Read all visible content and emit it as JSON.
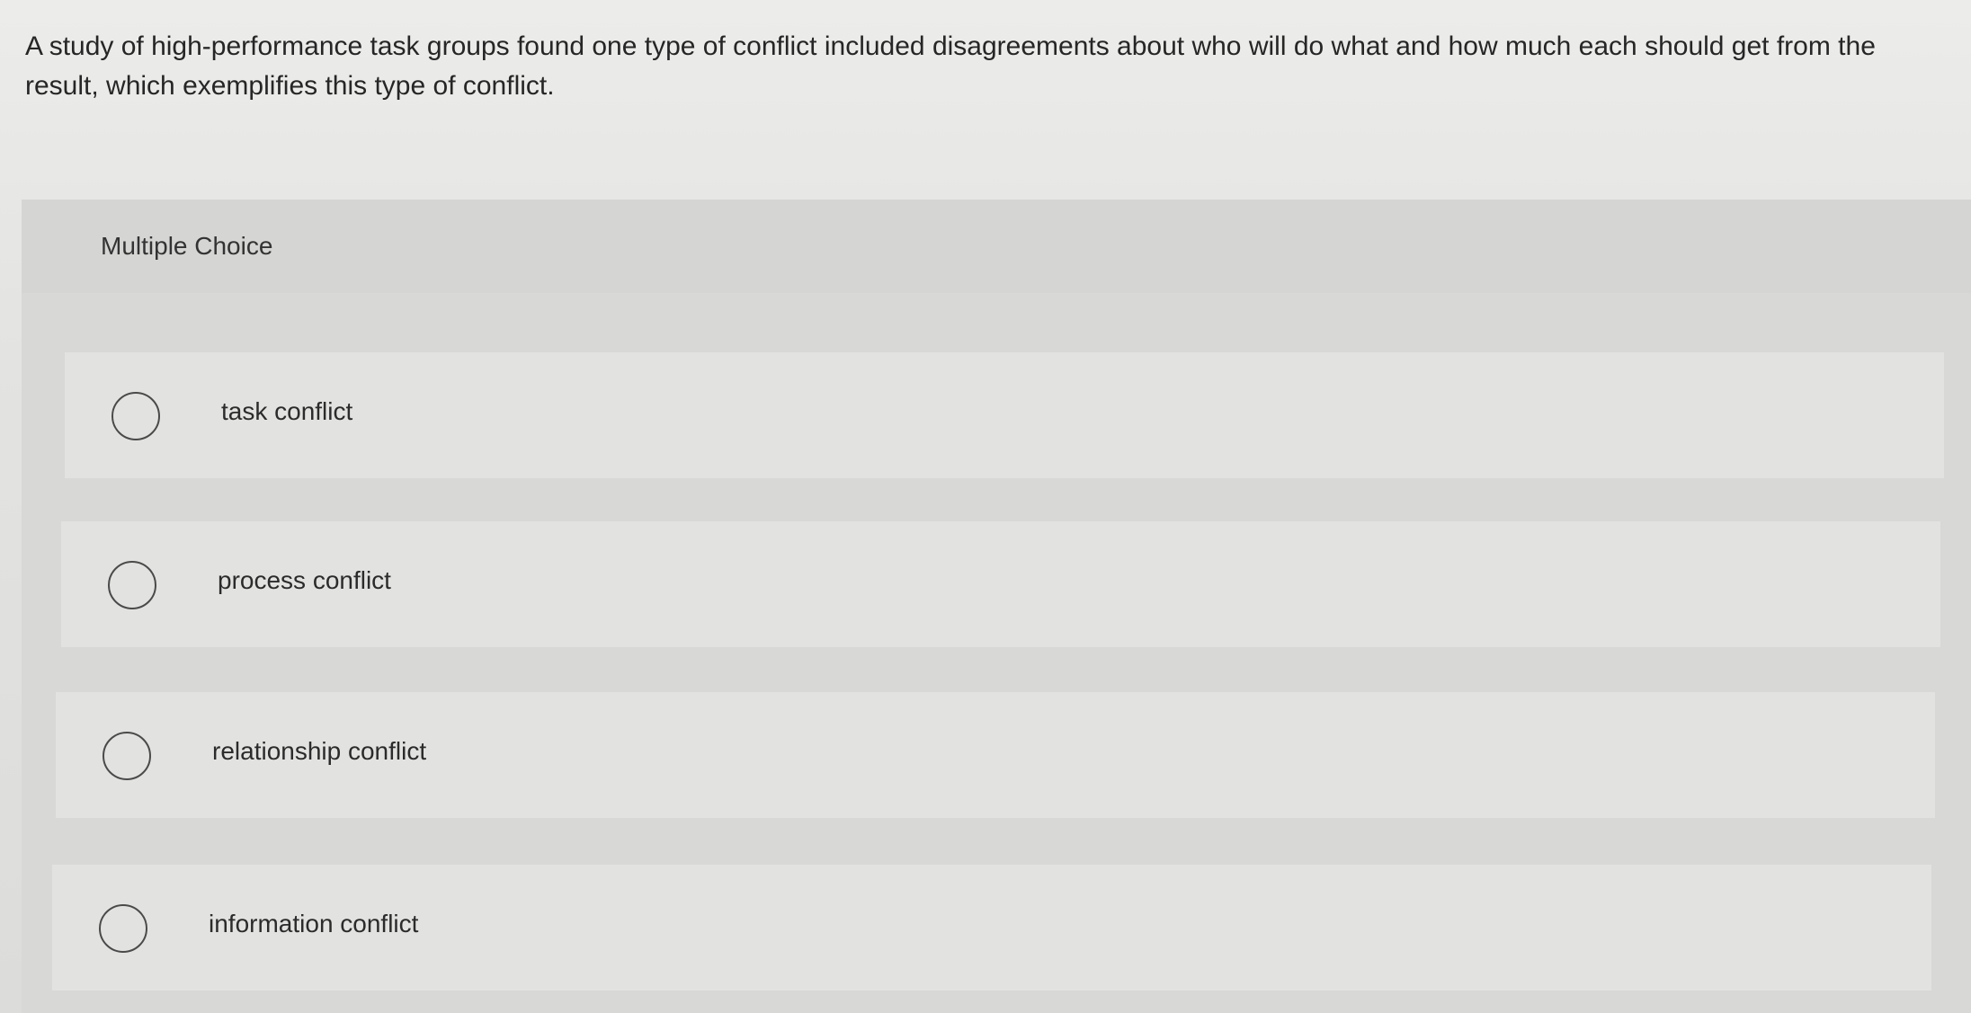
{
  "question": {
    "text": "A study of high-performance task groups found one type of conflict included disagreements about who will do what and how much each should get from the result, which exemplifies this type of conflict."
  },
  "multiple_choice": {
    "label": "Multiple Choice",
    "options": [
      {
        "label": "task conflict",
        "selected": false
      },
      {
        "label": "process conflict",
        "selected": false
      },
      {
        "label": "relationship conflict",
        "selected": false
      },
      {
        "label": "information conflict",
        "selected": false
      }
    ]
  }
}
